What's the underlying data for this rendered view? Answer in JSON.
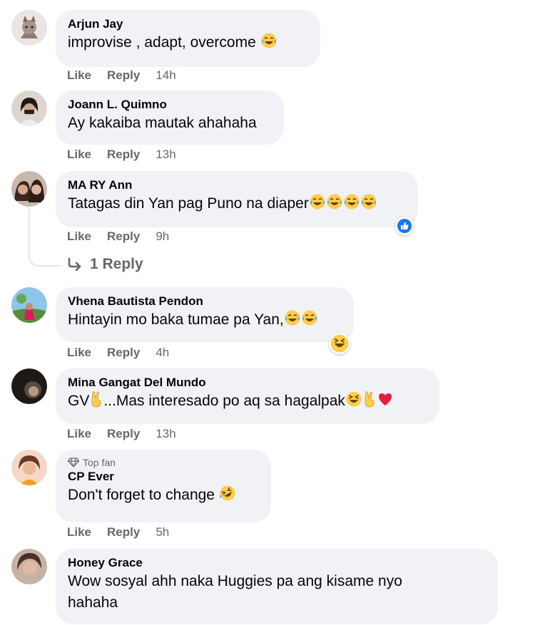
{
  "comments": [
    {
      "name": "Arjun Jay",
      "text": "improvise , adapt, overcome ",
      "like": "Like",
      "reply": "Reply",
      "time": "14h"
    },
    {
      "name": "Joann L. Quimno",
      "text": "Ay kakaiba mautak ahahaha",
      "like": "Like",
      "reply": "Reply",
      "time": "13h"
    },
    {
      "name": "MA RY Ann",
      "text": "Tatagas din Yan pag Puno na diaper",
      "like": "Like",
      "reply": "Reply",
      "time": "9h",
      "replies_link": "1 Reply"
    },
    {
      "name": "Vhena Bautista Pendon",
      "text": "Hintayin mo baka tumae pa Yan,",
      "like": "Like",
      "reply": "Reply",
      "time": "4h"
    },
    {
      "name": "Mina Gangat Del Mundo",
      "text_a": "GV",
      "text_b": "...Mas interesado po aq sa hagalpak",
      "like": "Like",
      "reply": "Reply",
      "time": "13h"
    },
    {
      "badge": "Top fan",
      "name": "CP Ever",
      "text": "Don't forget to change ",
      "like": "Like",
      "reply": "Reply",
      "time": "5h"
    },
    {
      "name": "Honey Grace",
      "text": "Wow sosyal ahh naka Huggies pa ang kisame nyo hahaha"
    }
  ],
  "colors": {
    "bubble": "#f0f2f5",
    "meta_text": "#65676b",
    "like_blue": "#1877f2",
    "heart": "#e41e3f",
    "emoji_yellow": "#ffcc4d"
  },
  "icons": [
    "tears-of-joy-emoji",
    "laughing-squint-emoji",
    "rofl-emoji",
    "victory-hand-emoji",
    "red-heart-emoji",
    "like-reaction-icon",
    "haha-reaction-icon",
    "reply-arrow-icon",
    "diamond-top-fan-icon"
  ]
}
